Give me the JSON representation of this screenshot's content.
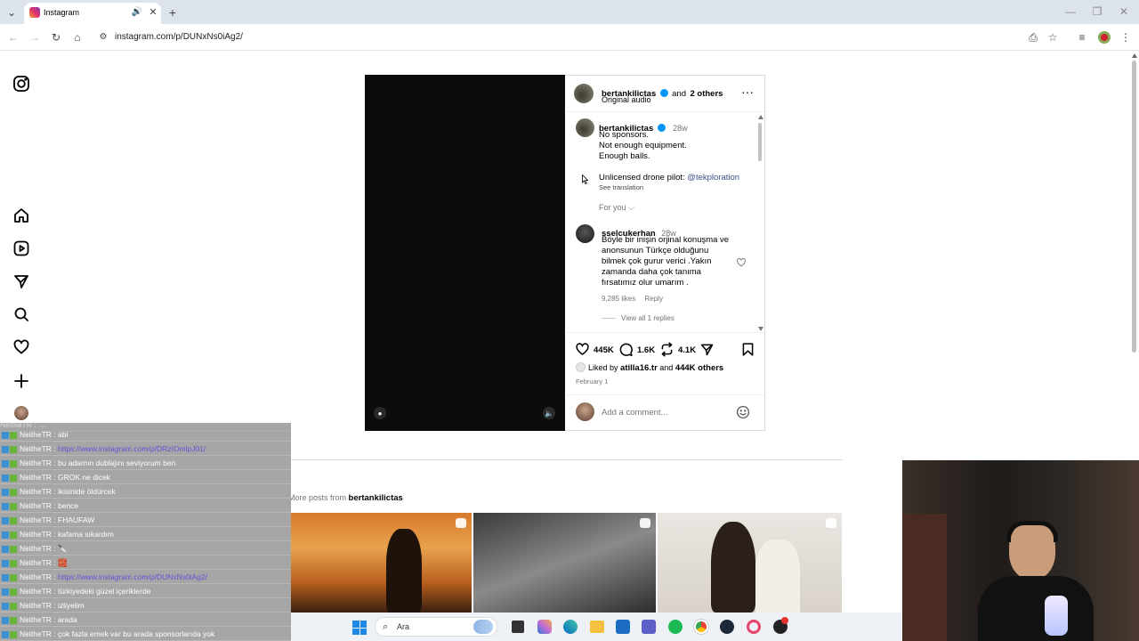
{
  "browser": {
    "tab_title": "Instagram",
    "url": "instagram.com/p/DUNxNs0iAg2/",
    "new_tab_symbol": "+"
  },
  "post": {
    "header": {
      "username": "bertankilictas",
      "and_text": "and",
      "others": "2 others",
      "audio": "Original audio"
    },
    "caption": {
      "username": "bertankilictas",
      "time": "28w",
      "lines": [
        "No sponsors.",
        "Not enough equipment.",
        "Enough balls."
      ],
      "drone_text": "Unlicensed drone pilot:",
      "drone_mention": "@tekploration",
      "see_translation": "See translation",
      "for_you": "For you"
    },
    "comment": {
      "username": "sselcukerhan",
      "time": "28w",
      "lines": [
        "Böyle bir inişin orjinal konuşma ve",
        "anonsunun Türkçe olduğunu",
        "bilmek çok gurur verici .Yakın",
        "zamanda daha çok tanıma",
        "fırsatımız olur umarım ."
      ],
      "likes": "9,285 likes",
      "reply": "Reply",
      "view_replies": "View all 1 replies"
    },
    "actions": {
      "likes": "445K",
      "comments": "1.6K",
      "reposts": "4.1K"
    },
    "liked_by": {
      "prefix": "Liked by",
      "user": "atilla16.tr",
      "and": "and",
      "others": "444K others"
    },
    "date": "February 1",
    "add_comment_placeholder": "Add a comment..."
  },
  "more_posts": {
    "prefix": "More posts from",
    "username": "bertankilictas"
  },
  "chat": {
    "top_partial": "NeitheTR : ...",
    "messages": [
      {
        "user": "NeitheTR",
        "text": "abi",
        "link": false
      },
      {
        "user": "NeitheTR",
        "text": "https://www.instagram.com/p/DRzIOmlpJ01/",
        "link": true
      },
      {
        "user": "NeitheTR",
        "text": "bu adamın dublajını seviyorum ben",
        "link": false
      },
      {
        "user": "NeitheTR",
        "text": "GROK ne dicek",
        "link": false
      },
      {
        "user": "NeitheTR",
        "text": "ikisinide öldürcek",
        "link": false
      },
      {
        "user": "NeitheTR",
        "text": "bence",
        "link": false
      },
      {
        "user": "NeitheTR",
        "text": "FHAUFAW",
        "link": false
      },
      {
        "user": "NeitheTR",
        "text": "kafama sıkardım",
        "link": false
      },
      {
        "user": "NeitheTR",
        "text": "🔪",
        "link": false
      },
      {
        "user": "NeitheTR",
        "text": "🧱",
        "link": false
      },
      {
        "user": "NeitheTR",
        "text": "https://www.instagram.com/p/DUNxNs0iAg2/",
        "link": true
      },
      {
        "user": "NeitheTR",
        "text": "türkiyedeki güzel içeriklerde",
        "link": false
      },
      {
        "user": "NeitheTR",
        "text": "izliyelim",
        "link": false
      },
      {
        "user": "NeitheTR",
        "text": "arada",
        "link": false
      },
      {
        "user": "NeitheTR",
        "text": "çok fazla emek var bu arada sponsorlarıda yok",
        "link": false
      }
    ]
  },
  "taskbar": {
    "search_placeholder": "Ara"
  },
  "colors": {
    "link_blue": "#385185",
    "verified_blue": "#0095f6",
    "chat_bg": "#a6a6a6",
    "taskbar_bg": "#eef1f5"
  }
}
